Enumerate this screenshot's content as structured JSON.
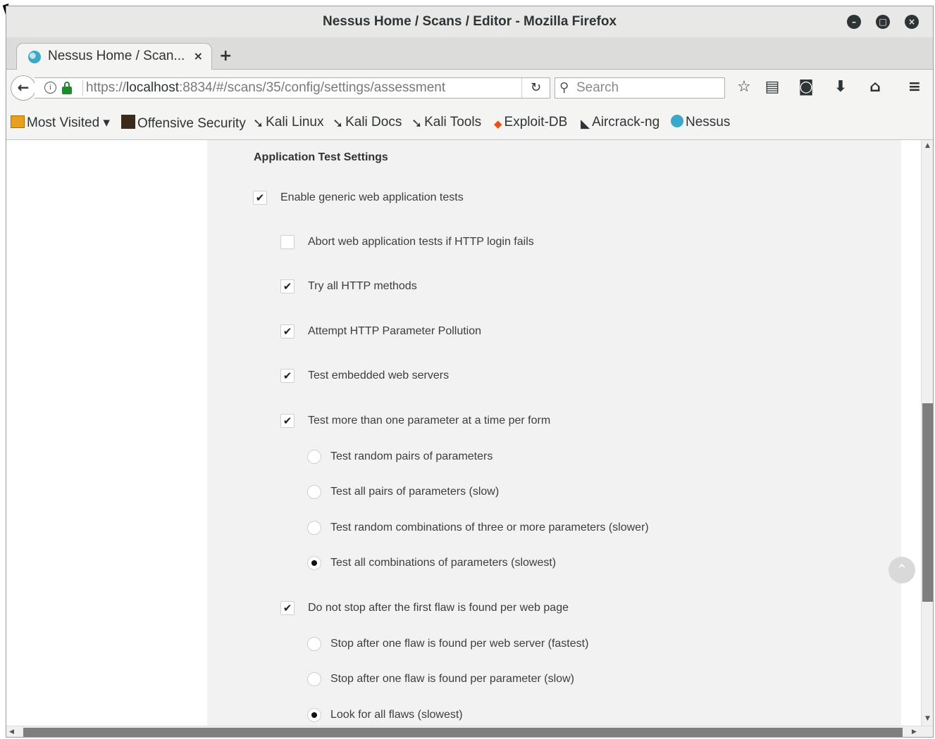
{
  "window": {
    "title": "Nessus Home / Scans / Editor - Mozilla Firefox",
    "controls": [
      "minimize-icon",
      "maximize-icon",
      "close-icon"
    ]
  },
  "tabs": [
    {
      "label": "Nessus Home / Scan...",
      "close": "×",
      "active": true
    }
  ],
  "new_tab": "+",
  "navbar": {
    "url_prefix": "https://",
    "url_host": "localhost",
    "url_rest": ":8834/#/scans/35/config/settings/assessment",
    "search_placeholder": "Search"
  },
  "bookmarks": [
    {
      "label": "Most Visited ▾",
      "icon": "folder-icon"
    },
    {
      "label": "Offensive Security",
      "icon": "offsec-icon"
    },
    {
      "label": "Kali Linux",
      "icon": "kali-dragon-icon"
    },
    {
      "label": "Kali Docs",
      "icon": "kali-dragon-icon"
    },
    {
      "label": "Kali Tools",
      "icon": "kali-dragon-icon"
    },
    {
      "label": "Exploit-DB",
      "icon": "exploit-db-icon"
    },
    {
      "label": "Aircrack-ng",
      "icon": "aircrack-icon"
    },
    {
      "label": "Nessus",
      "icon": "nessus-icon"
    }
  ],
  "content": {
    "section_title": "Application Test Settings",
    "options": {
      "enable_generic": {
        "label": "Enable generic web application tests",
        "checked": true
      },
      "abort_login": {
        "label": "Abort web application tests if HTTP login fails",
        "checked": false
      },
      "try_methods": {
        "label": "Try all HTTP methods",
        "checked": true
      },
      "param_pollution": {
        "label": "Attempt HTTP Parameter Pollution",
        "checked": true
      },
      "embedded_servers": {
        "label": "Test embedded web servers",
        "checked": true
      },
      "multi_param": {
        "label": "Test more than one parameter at a time per form",
        "checked": true
      },
      "no_stop": {
        "label": "Do not stop after the first flaw is found per web page",
        "checked": true
      }
    },
    "param_radios": [
      {
        "label": "Test random pairs of parameters",
        "selected": false
      },
      {
        "label": "Test all pairs of parameters (slow)",
        "selected": false
      },
      {
        "label": "Test random combinations of three or more parameters (slower)",
        "selected": false
      },
      {
        "label": "Test all combinations of parameters (slowest)",
        "selected": true
      }
    ],
    "flaw_radios": [
      {
        "label": "Stop after one flaw is found per web server (fastest)",
        "selected": false
      },
      {
        "label": "Stop after one flaw is found per parameter (slow)",
        "selected": false
      },
      {
        "label": "Look for all flaws (slowest)",
        "selected": true
      }
    ],
    "check_mark": "✔"
  }
}
